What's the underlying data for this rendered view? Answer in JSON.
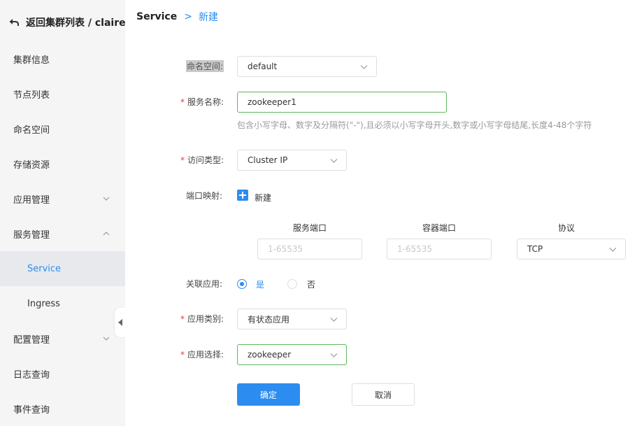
{
  "sidebar": {
    "back_label": "返回集群列表 / claire",
    "items": [
      {
        "label": "集群信息"
      },
      {
        "label": "节点列表"
      },
      {
        "label": "命名空间"
      },
      {
        "label": "存储资源"
      },
      {
        "label": "应用管理"
      },
      {
        "label": "服务管理"
      },
      {
        "label": "Service"
      },
      {
        "label": "Ingress"
      },
      {
        "label": "配置管理"
      },
      {
        "label": "日志查询"
      },
      {
        "label": "事件查询"
      }
    ]
  },
  "header": {
    "breadcrumb_root": "Service",
    "separator": ">",
    "breadcrumb_current": "新建"
  },
  "form": {
    "namespace": {
      "label": "命名空间:",
      "value": "default"
    },
    "service_name": {
      "required_mark": "*",
      "label": "服务名称:",
      "value": "zookeeper1",
      "hint": "包含小写字母、数字及分隔符(\"-\"),且必须以小写字母开头,数字或小写字母结尾,长度4-48个字符"
    },
    "access_type": {
      "required_mark": "*",
      "label": "访问类型:",
      "value": "Cluster IP"
    },
    "port_mapping": {
      "label": "端口映射:",
      "add_label": "新建",
      "columns": {
        "service_port": "服务端口",
        "container_port": "容器端口",
        "protocol": "协议"
      },
      "service_port_placeholder": "1-65535",
      "container_port_placeholder": "1-65535",
      "protocol_value": "TCP"
    },
    "linked_app": {
      "label": "关联应用:",
      "yes": "是",
      "no": "否",
      "selected": "是"
    },
    "app_category": {
      "required_mark": "*",
      "label": "应用类别:",
      "value": "有状态应用"
    },
    "app_select": {
      "required_mark": "*",
      "label": "应用选择:",
      "value": "zookeeper"
    }
  },
  "actions": {
    "confirm": "确定",
    "cancel": "取消"
  },
  "colors": {
    "accent": "#2d8cf0",
    "valid_border": "#5cb85c",
    "required": "#e4393c",
    "sidebar_bg": "#f5f5f6"
  }
}
